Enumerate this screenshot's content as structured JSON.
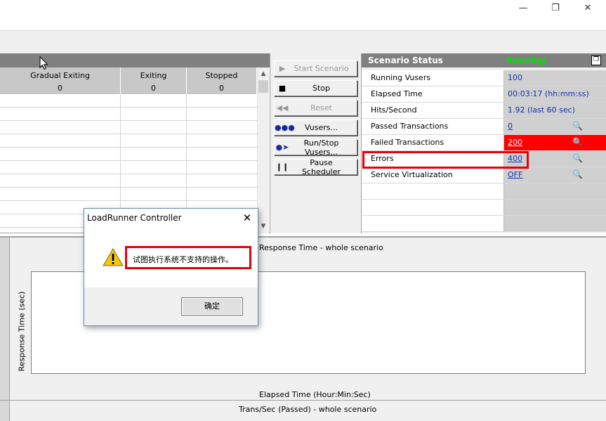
{
  "window": {
    "minimize_glyph": "—",
    "restore_glyph": "❐",
    "close_glyph": "✕"
  },
  "grid": {
    "columns": [
      {
        "name": "Gradual Exiting",
        "count": "0"
      },
      {
        "name": "Exiting",
        "count": "0"
      },
      {
        "name": "Stopped",
        "count": "0"
      }
    ]
  },
  "controls": {
    "start_scenario": "Start Scenario",
    "stop": "Stop",
    "reset": "Reset",
    "vusers": "Vusers...",
    "run_stop_vusers": "Run/Stop Vusers...",
    "pause_scheduler": "Pause Scheduler"
  },
  "scenario_status": {
    "title": "Scenario Status",
    "state": "Running",
    "rows": [
      {
        "label": "Running Vusers",
        "value": "100"
      },
      {
        "label": "Elapsed Time",
        "value": "00:03:17 (hh:mm:ss)"
      },
      {
        "label": "Hits/Second",
        "value": "1.92 (last 60 sec)"
      },
      {
        "label": "Passed Transactions",
        "value": "0"
      },
      {
        "label": "Failed Transactions",
        "value": "200"
      },
      {
        "label": "Errors",
        "value": "400"
      },
      {
        "label": "Service Virtualization",
        "value": "OFF"
      }
    ]
  },
  "graph": {
    "title": "Response Time - whole scenario",
    "ylabel": "Response Time (sec)",
    "xlabel": "Elapsed Time (Hour:Min:Sec)"
  },
  "bottom_graph": {
    "title": "Trans/Sec (Passed) - whole scenario"
  },
  "dialog": {
    "title": "LoadRunner Controller",
    "message": "试图执行系统不支持的操作。",
    "ok_label": "确定"
  },
  "colors": {
    "highlight": "#e8000a",
    "running": "#00e000",
    "failed_cell": "#ff0000",
    "link": "#1030b0"
  }
}
